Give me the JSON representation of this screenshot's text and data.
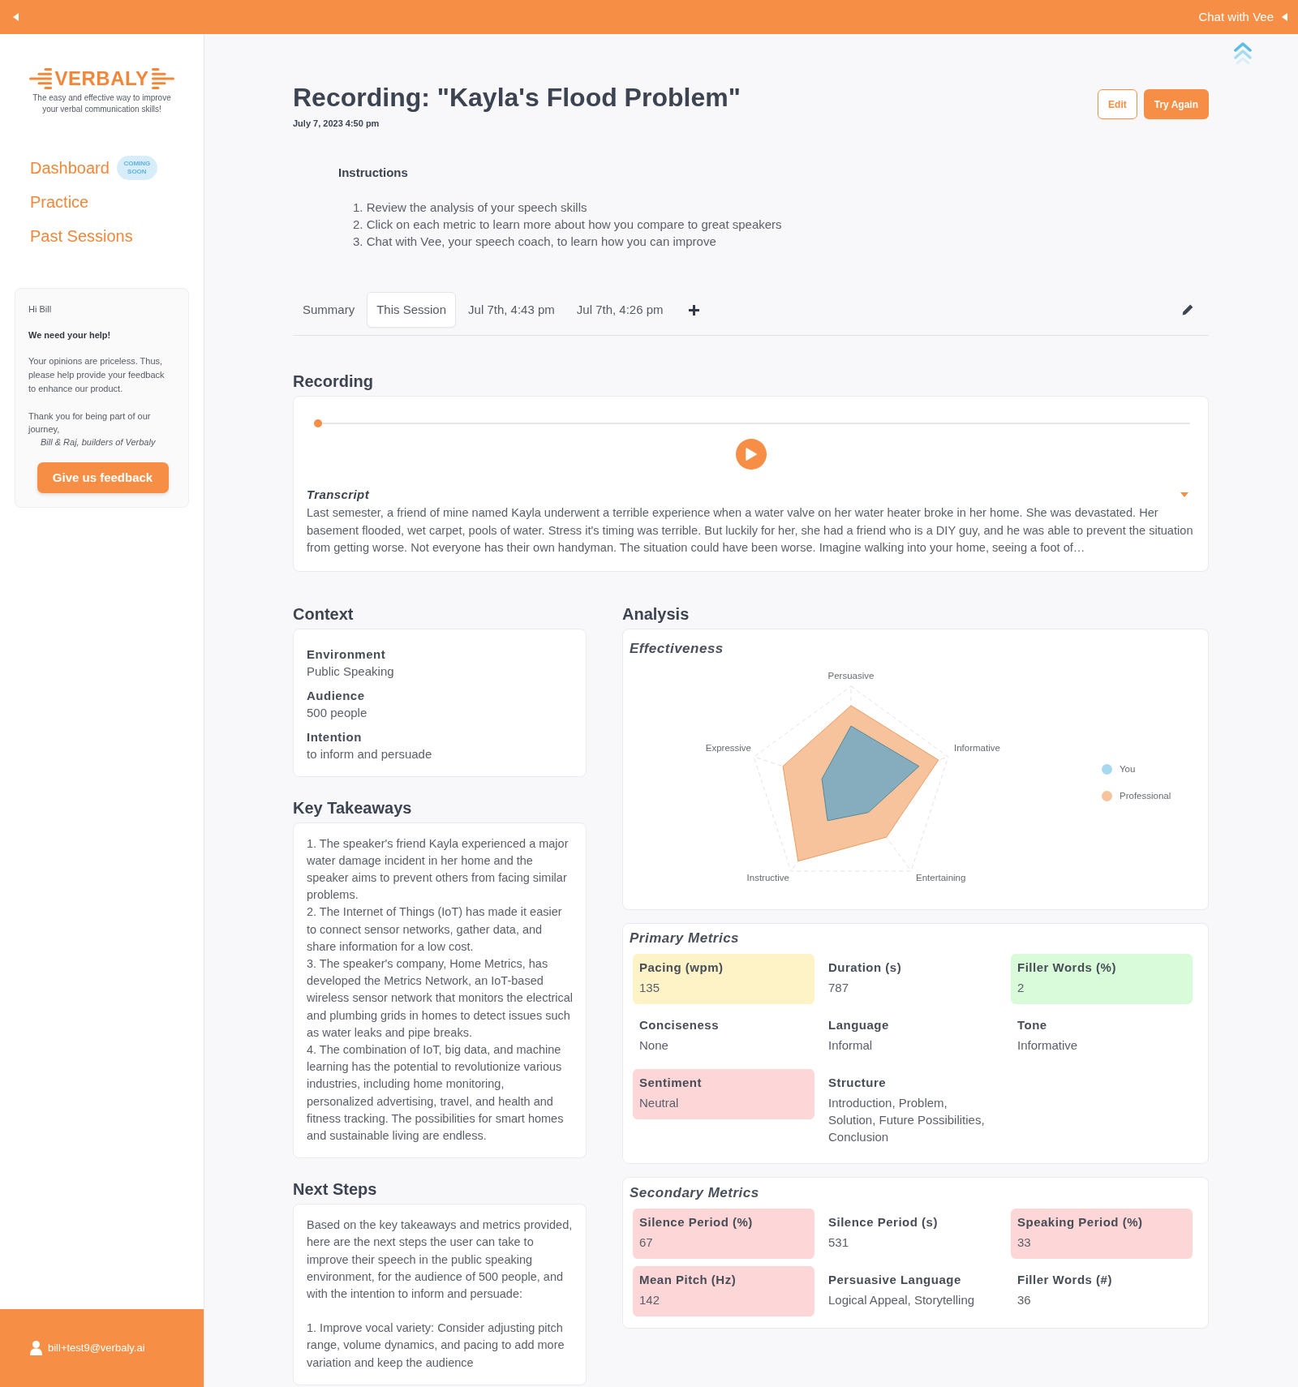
{
  "top_bar": {
    "chat_label": "Chat with Vee"
  },
  "sidebar": {
    "logo": {
      "wordmark": "VERBALY",
      "tagline": "The easy and effective way to improve your verbal communication skills!"
    },
    "nav": [
      {
        "label": "Dashboard",
        "badge": "COMING SOON"
      },
      {
        "label": "Practice"
      },
      {
        "label": "Past Sessions"
      }
    ],
    "feedback_card": {
      "greeting": "Hi Bill",
      "heading": "We need your help!",
      "message": "Your opinions are priceless. Thus, please help provide your feedback to enhance our product.",
      "thanks": "Thank you for being part of our journey,",
      "signature": "Bill & Raj, builders of Verbaly",
      "button": "Give us feedback"
    },
    "user": {
      "email": "bill+test9@verbaly.ai"
    }
  },
  "header": {
    "title": "Recording: \"Kayla's Flood Problem\"",
    "date": "July 7, 2023 4:50 pm",
    "buttons": [
      {
        "label": "Edit",
        "kind": "outline"
      },
      {
        "label": "Try Again",
        "kind": "primary"
      }
    ]
  },
  "instructions": {
    "heading": "Instructions",
    "steps": [
      "1. Review the analysis of your speech skills",
      "2. Click on each metric to learn more about how you compare to great speakers",
      "3. Chat with Vee, your speech coach, to learn how you can improve"
    ]
  },
  "tabs": [
    {
      "label": "Summary",
      "selected": false
    },
    {
      "label": "This Session",
      "selected": true
    },
    {
      "label": "Jul 7th, 4:43 pm",
      "selected": false
    },
    {
      "label": "Jul 7th, 4:26 pm",
      "selected": false
    }
  ],
  "recording": {
    "heading": "Recording",
    "playback": {
      "level": 0
    },
    "transcript_label": "Transcript",
    "transcript": "Last semester, a friend of mine named Kayla underwent a terrible experience when a water valve on her water heater broke in her home. She was devastated. Her basement flooded, wet carpet, pools of water. Stress it's timing was terrible. But luckily for her, she had a friend who is a DIY guy, and he was able to prevent the situation from getting worse. Not everyone has their own handyman. The situation could have been worse. Imagine walking into your home, seeing a foot of…"
  },
  "context": {
    "heading": "Context",
    "fields": [
      {
        "label": "Environment",
        "value": "Public Speaking"
      },
      {
        "label": "Audience",
        "value": "500 people"
      },
      {
        "label": "Intention",
        "value": "to inform and persuade"
      }
    ]
  },
  "key_takeaways": {
    "heading": "Key Takeaways",
    "items": [
      "1. The speaker's friend Kayla experienced a major water damage incident in her home and the speaker aims to prevent others from facing similar problems.",
      "2. The Internet of Things (IoT) has made it easier to connect sensor networks, gather data, and share information for a low cost.",
      "3. The speaker's company, Home Metrics, has developed the Metrics Network, an IoT-based wireless sensor network that monitors the electrical and plumbing grids in homes to detect issues such as water leaks and pipe breaks.",
      "4. The combination of IoT, big data, and machine learning has the potential to revolutionize various industries, including home monitoring, personalized advertising, travel, and health and fitness tracking. The possibilities for smart homes and sustainable living are endless."
    ]
  },
  "next_steps": {
    "heading": "Next Steps",
    "paragraphs": [
      "Based on the key takeaways and metrics provided, here are the next steps the user can take to improve their speech in the public speaking environment, for the audience of 500 people, and with the intention to inform and persuade:",
      "1. Improve vocal variety: Consider adjusting pitch range, volume dynamics, and pacing to add more variation and keep the audience"
    ]
  },
  "analysis": {
    "heading": "Analysis",
    "effectiveness": {
      "title": "Effectiveness",
      "axes": [
        "Persuasive",
        "Informative",
        "Entertaining",
        "Instructive",
        "Expressive"
      ],
      "legend": [
        {
          "label": "You",
          "color": "#a6d8ee"
        },
        {
          "label": "Professional",
          "color": "#f7c39c"
        }
      ]
    },
    "primary_metrics": {
      "title": "Primary Metrics",
      "items": [
        {
          "label": "Pacing (wpm)",
          "value": "135",
          "color": "#fef3c7"
        },
        {
          "label": "Duration (s)",
          "value": "787"
        },
        {
          "label": "Filler Words (%)",
          "value": "2",
          "color": "#d9fbd9"
        },
        {
          "label": "Conciseness",
          "value": "None"
        },
        {
          "label": "Language",
          "value": "Informal"
        },
        {
          "label": "Tone",
          "value": "Informative"
        },
        {
          "label": "Sentiment",
          "value": "Neutral",
          "color": "#fdd7d7"
        },
        {
          "label": "Structure",
          "value": "Introduction, Problem, Solution, Future Possibilities, Conclusion"
        }
      ]
    },
    "secondary_metrics": {
      "title": "Secondary Metrics",
      "items": [
        {
          "label": "Silence Period (%)",
          "value": "67",
          "color": "#fdd7d7"
        },
        {
          "label": "Silence Period (s)",
          "value": "531"
        },
        {
          "label": "Speaking Period (%)",
          "value": "33",
          "color": "#fdd7d7"
        },
        {
          "label": "Mean Pitch (Hz)",
          "value": "142",
          "color": "#fdd7d7"
        },
        {
          "label": "Persuasive Language",
          "value": "Logical Appeal, Storytelling"
        },
        {
          "label": "Filler Words (#)",
          "value": "36"
        }
      ]
    }
  }
}
